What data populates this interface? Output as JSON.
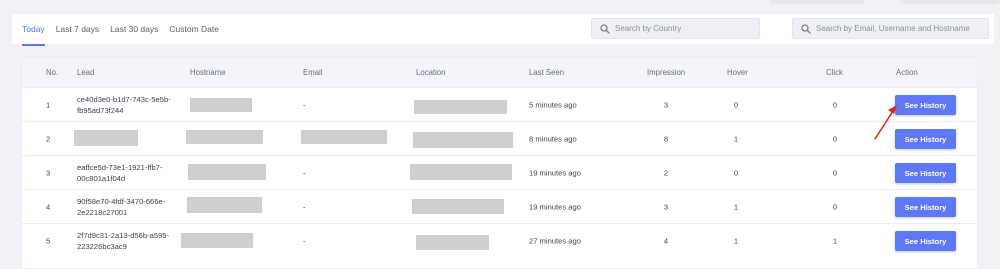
{
  "tabs": [
    {
      "label": "Today",
      "active": true
    },
    {
      "label": "Last 7 days",
      "active": false
    },
    {
      "label": "Last 30 days",
      "active": false
    },
    {
      "label": "Custom Date",
      "active": false
    }
  ],
  "search_country": {
    "placeholder": "Search by Country",
    "value": ""
  },
  "search_email": {
    "placeholder": "Search by Email, Username and Hostname",
    "value": ""
  },
  "table": {
    "columns": {
      "no": "No.",
      "lead": "Lead",
      "hostname": "Hostname",
      "email": "Email",
      "location": "Location",
      "last_seen": "Last Seen",
      "impression": "Impression",
      "hover": "Hover",
      "click": "Click",
      "action": "Action"
    },
    "rows": [
      {
        "no": "1",
        "lead_line1": "ce40d3e0-b1d7-743c-5e5b-",
        "lead_line2": "fb95ad73f244",
        "email": "-",
        "last_seen": "5 minutes ago",
        "impression": "3",
        "hover": "0",
        "click": "0",
        "action": "See History"
      },
      {
        "no": "2",
        "lead_line1": "",
        "lead_line2": "",
        "email": "",
        "last_seen": "8 minutes ago",
        "impression": "8",
        "hover": "1",
        "click": "0",
        "action": "See History"
      },
      {
        "no": "3",
        "lead_line1": "eaffce5d-73e1-1921-ffb7-",
        "lead_line2": "00c801a1f04d",
        "email": "-",
        "last_seen": "19 minutes ago",
        "impression": "2",
        "hover": "0",
        "click": "0",
        "action": "See History"
      },
      {
        "no": "4",
        "lead_line1": "90f58e70-4fdf-3470-666e-",
        "lead_line2": "2e2218c27001",
        "email": "-",
        "last_seen": "19 minutes ago",
        "impression": "3",
        "hover": "1",
        "click": "0",
        "action": "See History"
      },
      {
        "no": "5",
        "lead_line1": "2f7d9c31-2a13-d56b-a595-",
        "lead_line2": "223226bc3ac9",
        "email": "-",
        "last_seen": "27 minutes ago",
        "impression": "4",
        "hover": "1",
        "click": "1",
        "action": "See History"
      }
    ]
  },
  "colors": {
    "accent": "#5873f7",
    "button": "#5f78f8",
    "annotation_arrow": "#e0241b",
    "redaction": "#cfcfcf"
  },
  "icons": {
    "search": "search-icon"
  }
}
